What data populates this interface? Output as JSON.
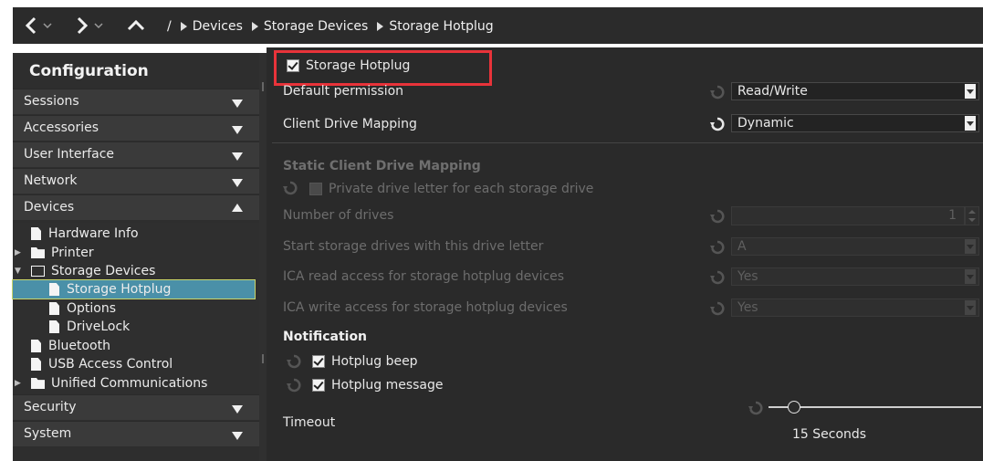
{
  "breadcrumb": {
    "root": "/",
    "items": [
      "Devices",
      "Storage Devices",
      "Storage Hotplug"
    ]
  },
  "sidebar": {
    "title": "Configuration",
    "sections_top": [
      {
        "label": "Sessions",
        "state": "collapsed"
      },
      {
        "label": "Accessories",
        "state": "collapsed"
      },
      {
        "label": "User Interface",
        "state": "collapsed"
      },
      {
        "label": "Network",
        "state": "collapsed"
      },
      {
        "label": "Devices",
        "state": "expanded"
      }
    ],
    "tree": [
      {
        "label": "Hardware Info",
        "icon": "file-icon"
      },
      {
        "label": "Printer",
        "icon": "folder-icon"
      },
      {
        "label": "Storage Devices",
        "icon": "folder-open-icon"
      },
      {
        "label": "Storage Hotplug",
        "icon": "file-icon",
        "selected": true
      },
      {
        "label": "Options",
        "icon": "file-icon"
      },
      {
        "label": "DriveLock",
        "icon": "file-icon"
      },
      {
        "label": "Bluetooth",
        "icon": "file-icon"
      },
      {
        "label": "USB Access Control",
        "icon": "file-icon"
      },
      {
        "label": "Unified Communications",
        "icon": "folder-icon"
      }
    ],
    "sections_bottom": [
      {
        "label": "Security",
        "state": "collapsed"
      },
      {
        "label": "System",
        "state": "collapsed"
      }
    ]
  },
  "main": {
    "storage_hotplug": {
      "label": "Storage Hotplug",
      "checked": true
    },
    "default_permission": {
      "label": "Default permission",
      "value": "Read/Write"
    },
    "client_drive_mapping": {
      "label": "Client Drive Mapping",
      "value": "Dynamic"
    },
    "static_mapping": {
      "title": "Static Client Drive Mapping",
      "private_letter": {
        "label": "Private drive letter for each storage drive",
        "checked": false
      },
      "number_of_drives": {
        "label": "Number of drives",
        "value": "1"
      },
      "start_letter": {
        "label": "Start storage drives with this drive letter",
        "value": "A"
      },
      "read_access": {
        "label": "ICA read access for storage hotplug devices",
        "value": "Yes"
      },
      "write_access": {
        "label": "ICA write access for storage hotplug devices",
        "value": "Yes"
      }
    },
    "notification": {
      "title": "Notification",
      "beep": {
        "label": "Hotplug beep",
        "checked": true
      },
      "message": {
        "label": "Hotplug message",
        "checked": true
      }
    },
    "timeout": {
      "label": "Timeout",
      "value_text": "15 Seconds",
      "slider_fraction": 0.12
    }
  },
  "colors": {
    "highlight_box": "#e8333a",
    "selected_item": "#4a90a8",
    "background": "#2a2a2a"
  }
}
